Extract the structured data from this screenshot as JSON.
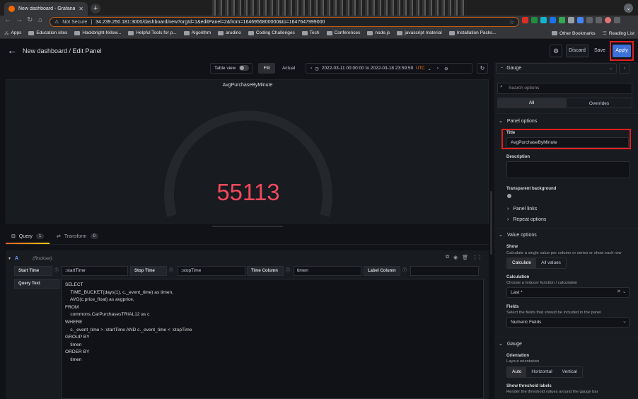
{
  "browser": {
    "tab_title": "New dashboard - Grafana",
    "security": "Not Secure",
    "url": "34.239.250.181:3000/dashboard/new?orgId=1&editPanel=2&from=1646956800000&to=1647647999000",
    "bookmarks": [
      "Apps",
      "Education sites",
      "Hackbright-fellow...",
      "Helpful Tools for p...",
      "Algorithm",
      "arudino",
      "Coding Challenges",
      "Tech",
      "Conferences",
      "node.js",
      "javascript material",
      "Installation Packs..."
    ],
    "other_bookmarks": "Other Bookmarks",
    "reading_list": "Reading List"
  },
  "header": {
    "title": "New dashboard / Edit Panel",
    "discard": "Discard",
    "save": "Save",
    "apply": "Apply"
  },
  "toolbar": {
    "table_view": "Table view",
    "fill": "Fill",
    "actual": "Actual",
    "time_range": "2022-03-11 00:00:00 to 2022-03-18 23:59:59",
    "utc": "UTC"
  },
  "panel": {
    "title": "AvgPurchaseByMinute",
    "value": "55113",
    "gauge_fraction": 0.0,
    "gauge_color": "#f2495c"
  },
  "query_tabs": {
    "query_label": "Query",
    "query_count": "1",
    "transform_label": "Transform",
    "transform_count": "0"
  },
  "query": {
    "name": "A",
    "datasource": "(Rockset)",
    "start_time_label": "Start Time",
    "start_time_value": ":startTime",
    "stop_time_label": "Stop Time",
    "stop_time_value": ":stopTime",
    "time_column_label": "Time Column",
    "time_column_value": "timen",
    "label_column_label": "Label Column",
    "label_column_value": "",
    "query_text_label": "Query Text",
    "query_text": "SELECT\n    TIME_BUCKET(days(1), c._event_time) as timen,\n    AVG(c.price_float) as avgprice,\nFROM\n    commons.CarPurchasesTRIAL12 as c\nWHERE\n    c._event_time > :startTime AND c._event_time < :stopTime\nGROUP BY\n    timen\nORDER BY\n    timen"
  },
  "options": {
    "visualization": "Gauge",
    "search_placeholder": "Search options",
    "all": "All",
    "overrides": "Overrides",
    "panel_options": "Panel options",
    "title_label": "Title",
    "title_value": "AvgPurchaseByMinute",
    "description_label": "Description",
    "transparent_label": "Transparent background",
    "panel_links": "Panel links",
    "repeat_options": "Repeat options",
    "value_options": "Value options",
    "show_label": "Show",
    "show_desc": "Calculate a single value per column or series or show each row",
    "calculate": "Calculate",
    "all_values": "All values",
    "calculation_label": "Calculation",
    "calculation_desc": "Choose a reducer function / calculation",
    "calculation_value": "Last *",
    "fields_label": "Fields",
    "fields_desc": "Select the fields that should be included in the panel",
    "fields_value": "Numeric Fields",
    "gauge_section": "Gauge",
    "orientation_label": "Orientation",
    "orientation_desc": "Layout orientation",
    "orient_auto": "Auto",
    "orient_horizontal": "Horizontal",
    "orient_vertical": "Vertical",
    "threshold_label": "Show threshold labels",
    "threshold_desc": "Render the threshold values around the gauge bar"
  }
}
